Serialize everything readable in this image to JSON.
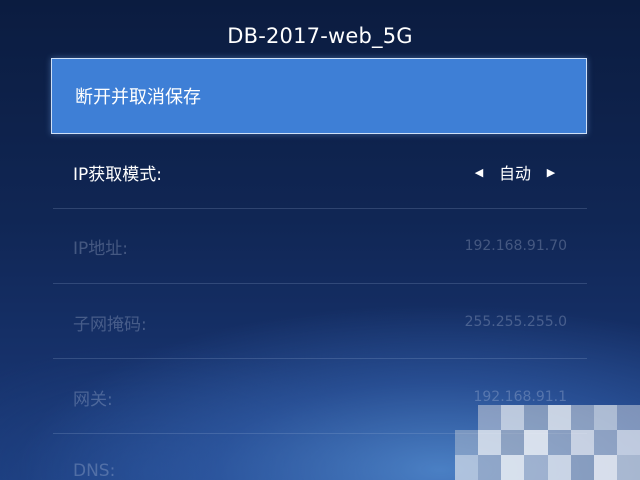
{
  "network": {
    "ssid": "DB-2017-web_5G"
  },
  "actions": {
    "forget_label": "断开并取消保存"
  },
  "settings": {
    "ip_mode": {
      "label": "IP获取模式:",
      "value": "自动"
    },
    "ip_address": {
      "label": "IP地址:",
      "value": "192.168.91.70"
    },
    "subnet_mask": {
      "label": "子网掩码:",
      "value": "255.255.255.0"
    },
    "gateway": {
      "label": "网关:",
      "value": "192.168.91.1"
    },
    "dns": {
      "label": "DNS:",
      "value": ""
    }
  },
  "colors": {
    "accent": "#3e7fd6",
    "background_top": "#0b1c40",
    "background_bottom": "#1c3d7e"
  },
  "icons": {
    "prev": "triangle-left-icon",
    "next": "triangle-right-icon"
  }
}
